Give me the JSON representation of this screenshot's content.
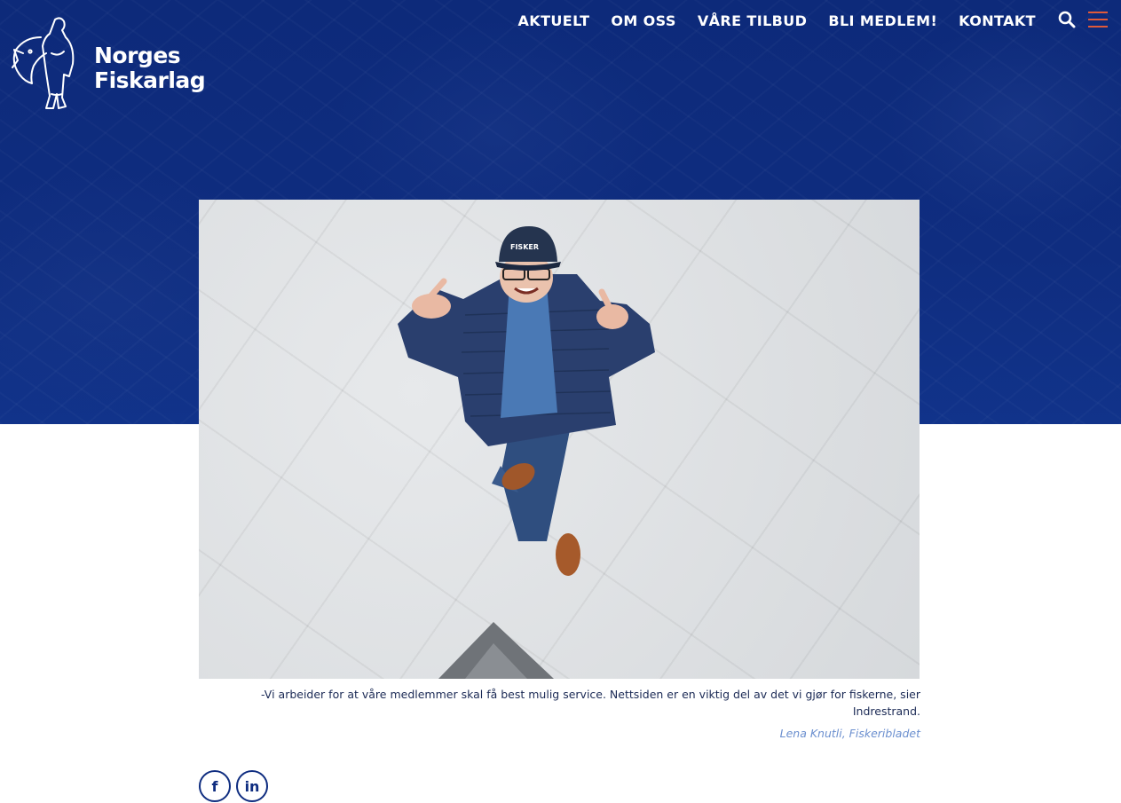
{
  "header": {
    "logo_line1": "Norges",
    "logo_line2": "Fiskarlag",
    "nav": [
      "AKTUELT",
      "OM OSS",
      "VÅRE TILBUD",
      "BLI MEDLEM!",
      "KONTAKT"
    ],
    "icons": [
      "search-icon",
      "menu-icon"
    ]
  },
  "article": {
    "caption": "-Vi arbeider for at våre medlemmer skal få best mulig service. Nettsiden er en viktig del av det vi gjør for fiskerne, sier Indrestrand.",
    "credit": "Lena Knutli, Fiskeribladet",
    "cap_text": "FISKER"
  },
  "share": {
    "facebook": "f",
    "linkedin": "in"
  },
  "colors": {
    "brand_blue": "#0f2d80",
    "accent": "#e05a3a",
    "credit_blue": "#6b8fcf"
  }
}
